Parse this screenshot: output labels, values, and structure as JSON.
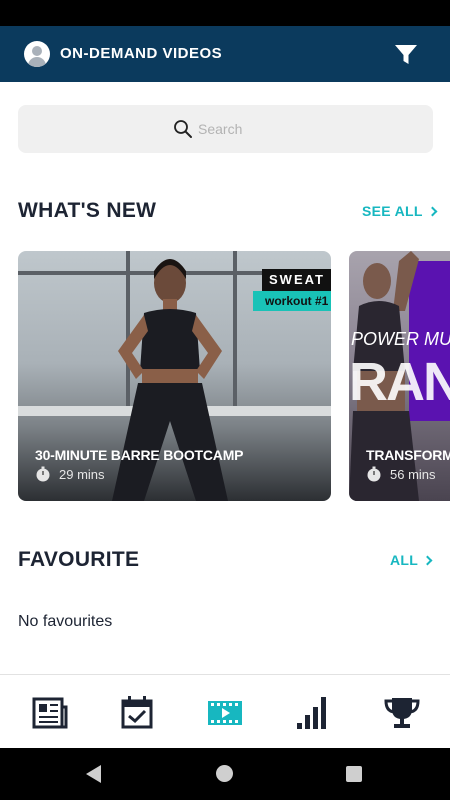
{
  "header": {
    "title": "ON-DEMAND VIDEOS",
    "avatar_icon": "user-avatar-icon",
    "filter_icon": "filter-icon"
  },
  "search": {
    "placeholder": "Search"
  },
  "whats_new": {
    "title": "WHAT'S NEW",
    "link_label": "SEE ALL",
    "cards": [
      {
        "title": "30-MINUTE BARRE BOOTCAMP",
        "duration": "29 mins",
        "badge": "SWEAT",
        "badge_sub": "workout #1"
      },
      {
        "title": "TRANSFORM",
        "duration": "56 mins",
        "overlay_text": "POWER MUS",
        "overlay_big": "RAN"
      }
    ]
  },
  "favourite": {
    "title": "FAVOURITE",
    "link_label": "ALL",
    "empty_text": "No favourites"
  },
  "bottom_nav": {
    "items": [
      {
        "icon": "news-icon",
        "active": false
      },
      {
        "icon": "calendar-check-icon",
        "active": false
      },
      {
        "icon": "video-film-icon",
        "active": true
      },
      {
        "icon": "bar-chart-icon",
        "active": false
      },
      {
        "icon": "trophy-icon",
        "active": false
      }
    ]
  },
  "colors": {
    "header_bg": "#0b3a5d",
    "accent": "#17b7c0",
    "text_dark": "#1d2433"
  }
}
